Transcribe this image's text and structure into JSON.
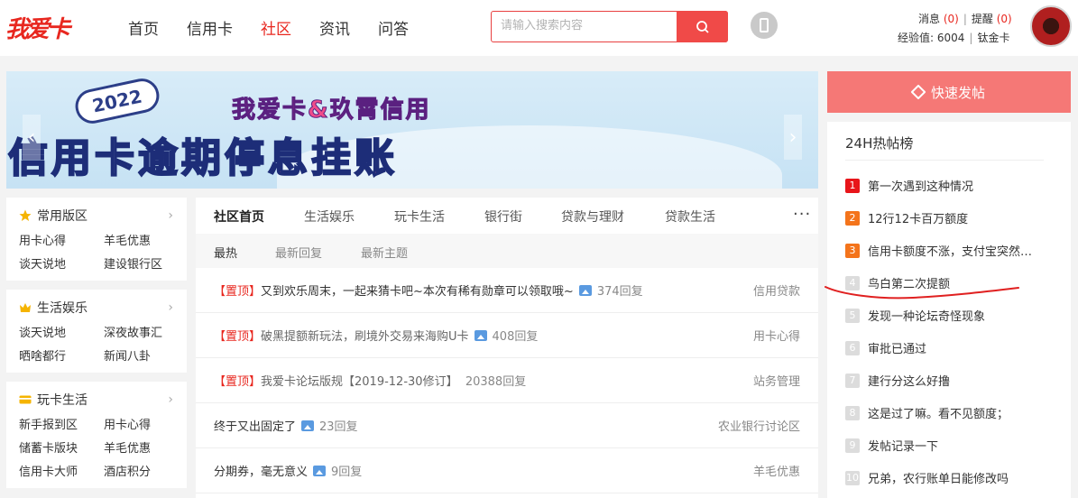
{
  "header": {
    "logo": "我爱卡",
    "nav": [
      "首页",
      "信用卡",
      "社区",
      "资讯",
      "问答"
    ],
    "nav_active": "社区",
    "search_placeholder": "请输入搜索内容",
    "messages_label": "消息",
    "messages_count": "(0)",
    "reminders_label": "提醒",
    "reminders_count": "(0)",
    "exp_label": "经验值:",
    "exp_value": "6004",
    "level": "钛金卡"
  },
  "banner": {
    "year_tag": "2022",
    "line1": "我爱卡&玖霄信用",
    "line2_a": "信用卡逾期",
    "line2_b": "停息挂账"
  },
  "sidebar": [
    {
      "title": "常用版区",
      "icon": "star-icon",
      "icon_color": "#f5b400",
      "items": [
        "用卡心得",
        "羊毛优惠",
        "谈天说地",
        "建设银行区"
      ]
    },
    {
      "title": "生活娱乐",
      "icon": "crown-icon",
      "icon_color": "#f5b400",
      "items": [
        "谈天说地",
        "深夜故事汇",
        "晒啥都行",
        "新闻八卦"
      ]
    },
    {
      "title": "玩卡生活",
      "icon": "card-icon",
      "icon_color": "#f5b400",
      "items": [
        "新手报到区",
        "用卡心得",
        "储蓄卡版块",
        "羊毛优惠",
        "信用卡大师",
        "酒店积分"
      ]
    }
  ],
  "main": {
    "tabs": [
      "社区首页",
      "生活娱乐",
      "玩卡生活",
      "银行街",
      "贷款与理财",
      "贷款生活"
    ],
    "tab_active": "社区首页",
    "more": "···",
    "subtabs": [
      "最热",
      "最新回复",
      "最新主题"
    ],
    "subtab_active": "最热",
    "posts": [
      {
        "pin": "【置顶】",
        "title": "又到欢乐周末，一起来猜卡吧~本次有稀有勋章可以领取哦~",
        "has_image": true,
        "replies": "374回复",
        "forum": "信用贷款"
      },
      {
        "pin": "【置顶】",
        "title": "破黑提额新玩法，刷境外交易来海购U卡",
        "has_image": true,
        "replies": "408回复",
        "forum": "用卡心得"
      },
      {
        "pin": "【置顶】",
        "title": "我爱卡论坛版规【2019-12-30修订】",
        "has_image": false,
        "replies": "20388回复",
        "forum": "站务管理"
      },
      {
        "pin": "",
        "title": "终于又出固定了",
        "has_image": true,
        "replies": "23回复",
        "forum": "农业银行讨论区"
      },
      {
        "pin": "",
        "title": "分期券，毫无意义",
        "has_image": true,
        "replies": "9回复",
        "forum": "羊毛优惠"
      }
    ]
  },
  "right": {
    "quick_post": "快速发帖",
    "hot_title": "24H热帖榜",
    "hot": [
      {
        "rank": "1",
        "title": "第一次遇到这种情况"
      },
      {
        "rank": "2",
        "title": "12行12卡百万额度"
      },
      {
        "rank": "3",
        "title": "信用卡额度不涨，支付宝突然…"
      },
      {
        "rank": "4",
        "title": "鸟白第二次提额"
      },
      {
        "rank": "5",
        "title": "发现一种论坛奇怪现象"
      },
      {
        "rank": "6",
        "title": "审批已通过"
      },
      {
        "rank": "7",
        "title": "建行分这么好撸"
      },
      {
        "rank": "8",
        "title": "这是过了嘛。看不见额度；"
      },
      {
        "rank": "9",
        "title": "发帖记录一下"
      },
      {
        "rank": "10",
        "title": "兄弟，农行账单日能修改吗"
      }
    ]
  },
  "colors": {
    "brand": "#e8271f",
    "accent_button": "#f57876",
    "rank_top": "#e8151a",
    "rank_second": "#f4741b",
    "scribble": "#e02020"
  }
}
